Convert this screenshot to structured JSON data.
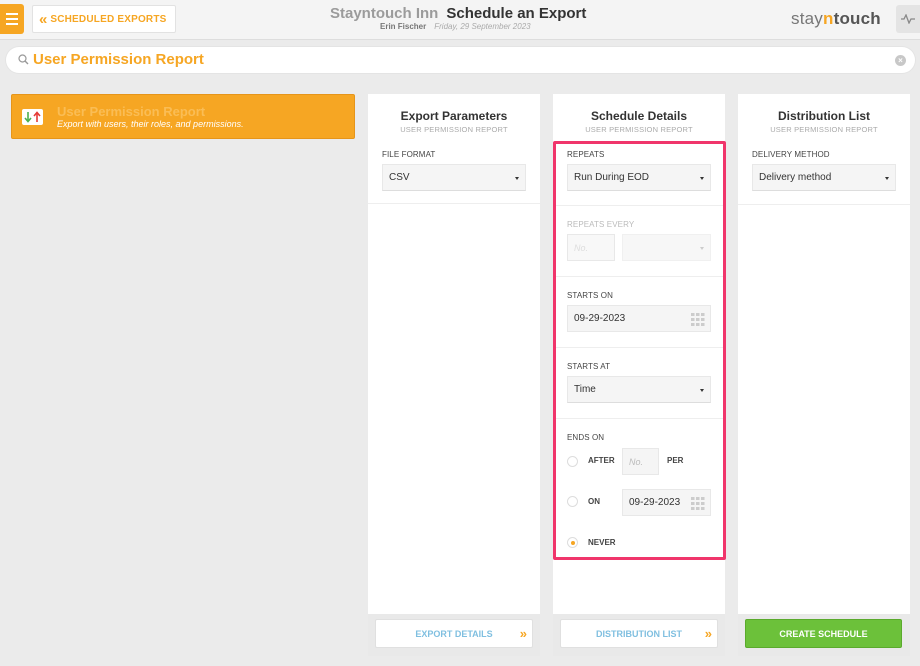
{
  "header": {
    "back_label": "SCHEDULED EXPORTS",
    "hotel_name": "Stayntouch Inn",
    "page_title": "Schedule an Export",
    "user_name": "Erin Fischer",
    "date": "Friday, 29 September 2023",
    "logo_pre": "stay",
    "logo_n": "n",
    "logo_post": "touch"
  },
  "search": {
    "value": "User Permission Report"
  },
  "report": {
    "title": "User Permission Report",
    "description": "Export with users, their roles, and permissions."
  },
  "export_parameters": {
    "title": "Export Parameters",
    "subtitle": "USER PERMISSION REPORT",
    "file_format_label": "FILE FORMAT",
    "file_format_value": "CSV",
    "footer_button": "EXPORT DETAILS"
  },
  "schedule_details": {
    "title": "Schedule Details",
    "subtitle": "USER PERMISSION REPORT",
    "repeats_label": "REPEATS",
    "repeats_value": "Run During EOD",
    "repeats_every_label": "REPEATS EVERY",
    "repeats_every_placeholder": "No.",
    "starts_on_label": "STARTS ON",
    "starts_on_value": "09-29-2023",
    "starts_at_label": "STARTS AT",
    "starts_at_value": "Time",
    "ends_on_label": "ENDS ON",
    "after_label": "AFTER",
    "after_placeholder": "No.",
    "per_label": "PER",
    "on_label": "ON",
    "on_date_value": "09-29-2023",
    "never_label": "NEVER",
    "selected_end_option": "never",
    "footer_button": "DISTRIBUTION LIST"
  },
  "distribution_list": {
    "title": "Distribution List",
    "subtitle": "USER PERMISSION REPORT",
    "delivery_method_label": "DELIVERY METHOD",
    "delivery_method_value": "Delivery method",
    "footer_button": "CREATE SCHEDULE"
  },
  "colors": {
    "accent": "#f6a623",
    "highlight": "#f0356b",
    "create": "#6cc13a",
    "link_blue": "#7fbfe0"
  }
}
